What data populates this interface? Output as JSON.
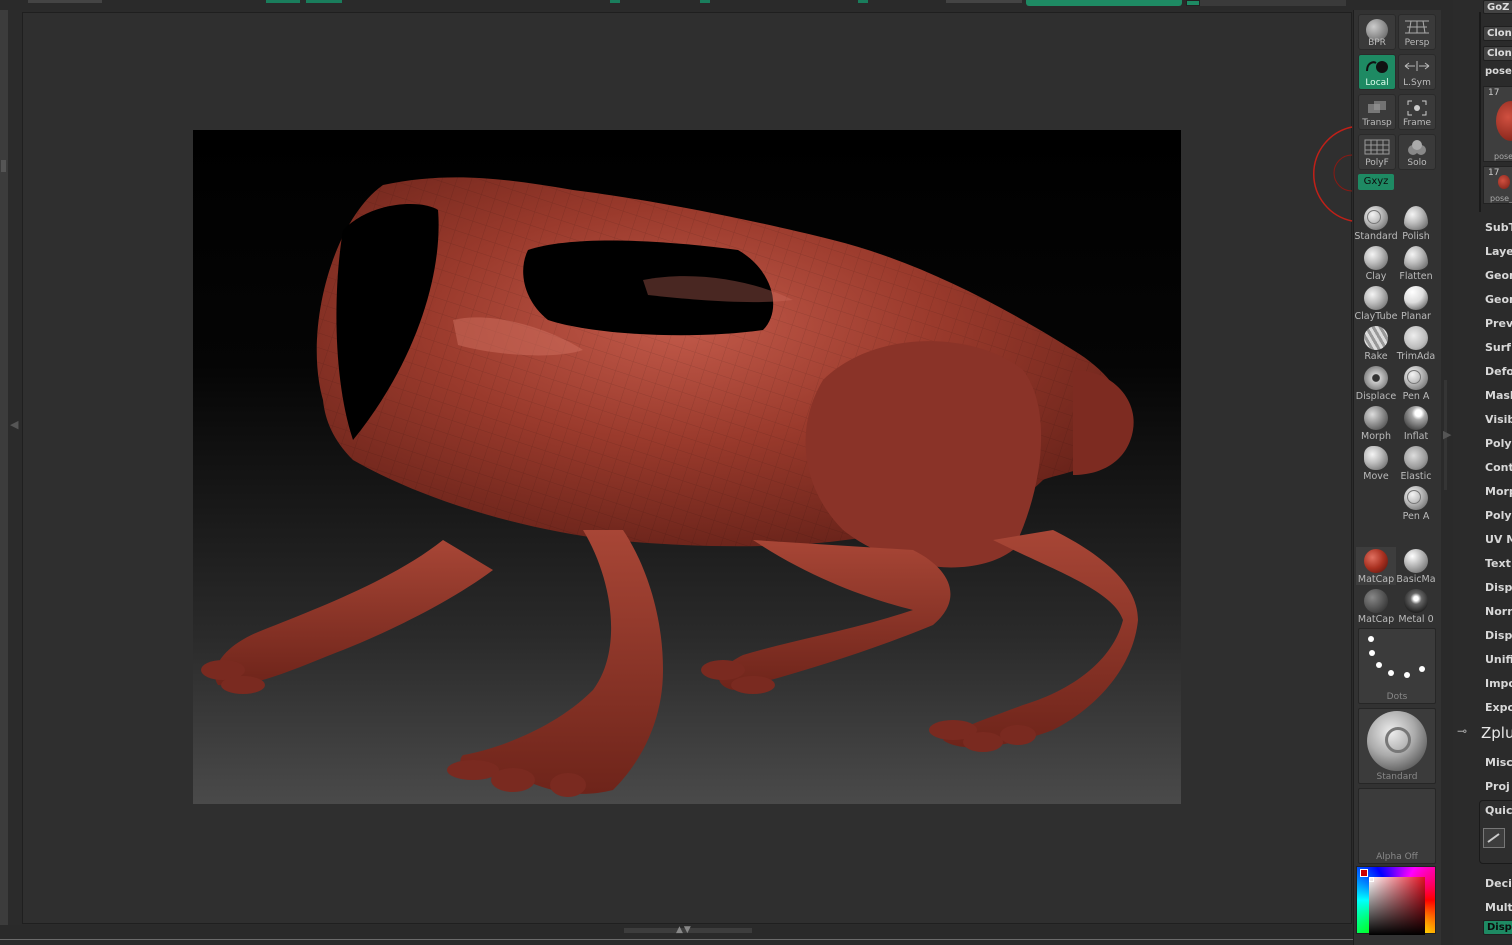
{
  "colors": {
    "accent": "#1e8a63",
    "model": "#9c3a2d",
    "background": "#2b2b2b"
  },
  "shelf": {
    "view_buttons": [
      {
        "label": "BPR",
        "icon": "bpr-sphere-icon"
      },
      {
        "label": "Persp",
        "icon": "perspective-grid-icon"
      },
      {
        "label": "Local",
        "icon": "local-rotate-icon"
      },
      {
        "label": "L.Sym",
        "icon": "local-symmetry-icon"
      },
      {
        "label": "Transp",
        "icon": "transparency-icon"
      },
      {
        "label": "Frame",
        "icon": "frame-icon"
      },
      {
        "label": "PolyF",
        "icon": "polyframe-grid-icon"
      },
      {
        "label": "Solo",
        "icon": "solo-icon"
      }
    ],
    "xyz_label": "Gxyz",
    "brushes": [
      {
        "label": "Standard"
      },
      {
        "label": "Polish"
      },
      {
        "label": "Clay"
      },
      {
        "label": "Flatten"
      },
      {
        "label": "ClayTube"
      },
      {
        "label": "Planar"
      },
      {
        "label": "Rake"
      },
      {
        "label": "TrimAda"
      },
      {
        "label": "Displace"
      },
      {
        "label": "Pen  A"
      },
      {
        "label": "Morph"
      },
      {
        "label": "Inflat"
      },
      {
        "label": "Move"
      },
      {
        "label": "Elastic"
      },
      {
        "label": "Pen  A"
      }
    ],
    "materials": [
      {
        "label": "MatCap"
      },
      {
        "label": "BasicMa"
      },
      {
        "label": "MatCap"
      },
      {
        "label": "Metal  0"
      }
    ],
    "stroke_label": "Dots",
    "current_brush_label": "Standard",
    "alpha_label": "Alpha  Off"
  },
  "panel": {
    "top_buttons": [
      "GoZ",
      "Clone",
      "Clone"
    ],
    "pose_label": "pose",
    "tool_thumbs": [
      {
        "count": "17",
        "name": "pose"
      },
      {
        "count": "17",
        "name": "pose_"
      }
    ],
    "menu_items": [
      "SubT",
      "Laye",
      "Geon",
      "Geon",
      "Prev",
      "Surf",
      "Defo",
      "Mask",
      "Visib",
      "Poly",
      "Cont",
      "Morp",
      "Polyp",
      "UV M",
      "Text",
      "Displ",
      "Norn",
      "Displ",
      "Unifi",
      "Impo",
      "Expo"
    ],
    "zplugin_label": "Zplu",
    "menu_items_2": [
      "Misc",
      "Proj"
    ],
    "quick_label": "Quick",
    "decimation_label": "Deci",
    "multi_label": "Multi",
    "displ_button": "Displ"
  }
}
